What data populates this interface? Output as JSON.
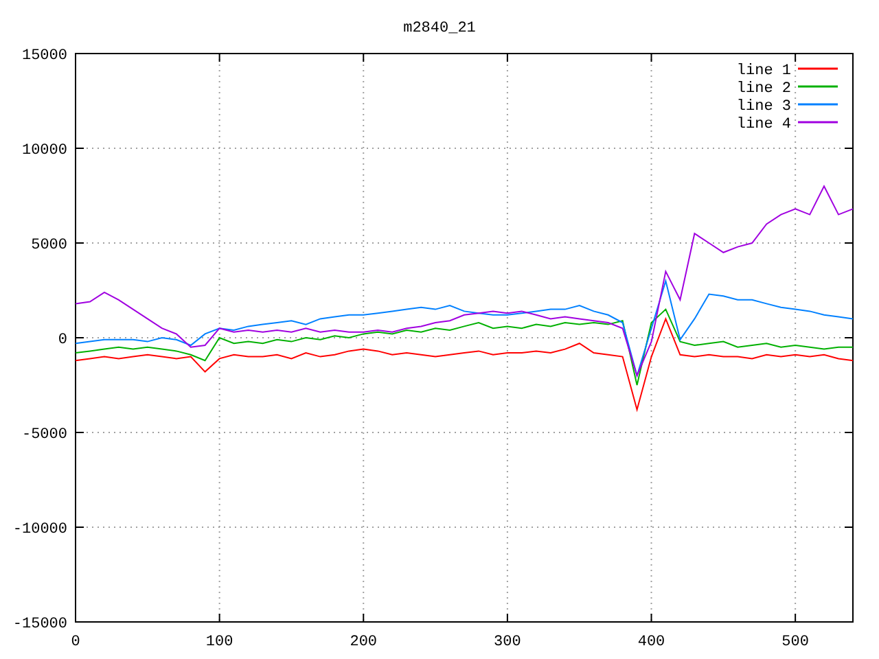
{
  "chart_data": {
    "type": "line",
    "title": "m2840_21",
    "grid": true,
    "legend": true,
    "xlim": [
      0,
      540
    ],
    "ylim": [
      -15000,
      15000
    ],
    "xticks": [
      0,
      100,
      200,
      300,
      400,
      500
    ],
    "yticks": [
      -15000,
      -10000,
      -5000,
      0,
      5000,
      10000,
      15000
    ],
    "x": [
      0,
      10,
      20,
      30,
      40,
      50,
      60,
      70,
      80,
      90,
      100,
      110,
      120,
      130,
      140,
      150,
      160,
      170,
      180,
      190,
      200,
      210,
      220,
      230,
      240,
      250,
      260,
      270,
      280,
      290,
      300,
      310,
      320,
      330,
      340,
      350,
      360,
      370,
      380,
      390,
      400,
      410,
      420,
      430,
      440,
      450,
      460,
      470,
      480,
      490,
      500,
      510,
      520,
      530,
      540
    ],
    "series": [
      {
        "name": "line 1",
        "color": "#ff0000",
        "values": [
          -1200,
          -1100,
          -1000,
          -1100,
          -1000,
          -900,
          -1000,
          -1100,
          -1000,
          -1800,
          -1100,
          -900,
          -1000,
          -1000,
          -900,
          -1100,
          -800,
          -1000,
          -900,
          -700,
          -600,
          -700,
          -900,
          -800,
          -900,
          -1000,
          -900,
          -800,
          -700,
          -900,
          -800,
          -800,
          -700,
          -800,
          -600,
          -300,
          -800,
          -900,
          -1000,
          -3800,
          -1000,
          1000,
          -900,
          -1000,
          -900,
          -1000,
          -1000,
          -1100,
          -900,
          -1000,
          -900,
          -1000,
          -900,
          -1100,
          -1200
        ]
      },
      {
        "name": "line 2",
        "color": "#00b000",
        "values": [
          -800,
          -700,
          -600,
          -500,
          -600,
          -500,
          -600,
          -700,
          -900,
          -1200,
          0,
          -300,
          -200,
          -300,
          -100,
          -200,
          0,
          -100,
          100,
          0,
          200,
          300,
          200,
          400,
          300,
          500,
          400,
          600,
          800,
          500,
          600,
          500,
          700,
          600,
          800,
          700,
          800,
          700,
          900,
          -2500,
          800,
          1500,
          -200,
          -400,
          -300,
          -200,
          -500,
          -400,
          -300,
          -500,
          -400,
          -500,
          -600,
          -500,
          -500
        ]
      },
      {
        "name": "line 3",
        "color": "#0080ff",
        "values": [
          -300,
          -200,
          -100,
          -100,
          -100,
          -200,
          0,
          -100,
          -400,
          200,
          500,
          400,
          600,
          700,
          800,
          900,
          700,
          1000,
          1100,
          1200,
          1200,
          1300,
          1400,
          1500,
          1600,
          1500,
          1700,
          1400,
          1300,
          1200,
          1200,
          1300,
          1400,
          1500,
          1500,
          1700,
          1400,
          1200,
          800,
          -2000,
          500,
          3000,
          -100,
          1000,
          2300,
          2200,
          2000,
          2000,
          1800,
          1600,
          1500,
          1400,
          1200,
          1100,
          1000
        ]
      },
      {
        "name": "line 4",
        "color": "#a000e0",
        "values": [
          1800,
          1900,
          2400,
          2000,
          1500,
          1000,
          500,
          200,
          -500,
          -400,
          500,
          300,
          400,
          300,
          400,
          300,
          500,
          300,
          400,
          300,
          300,
          400,
          300,
          500,
          600,
          800,
          900,
          1200,
          1300,
          1400,
          1300,
          1400,
          1200,
          1000,
          1100,
          1000,
          900,
          800,
          500,
          -2000,
          -200,
          3500,
          2000,
          5500,
          5000,
          4500,
          4800,
          5000,
          6000,
          6500,
          6800,
          6500,
          8000,
          6500,
          6800
        ]
      }
    ]
  }
}
